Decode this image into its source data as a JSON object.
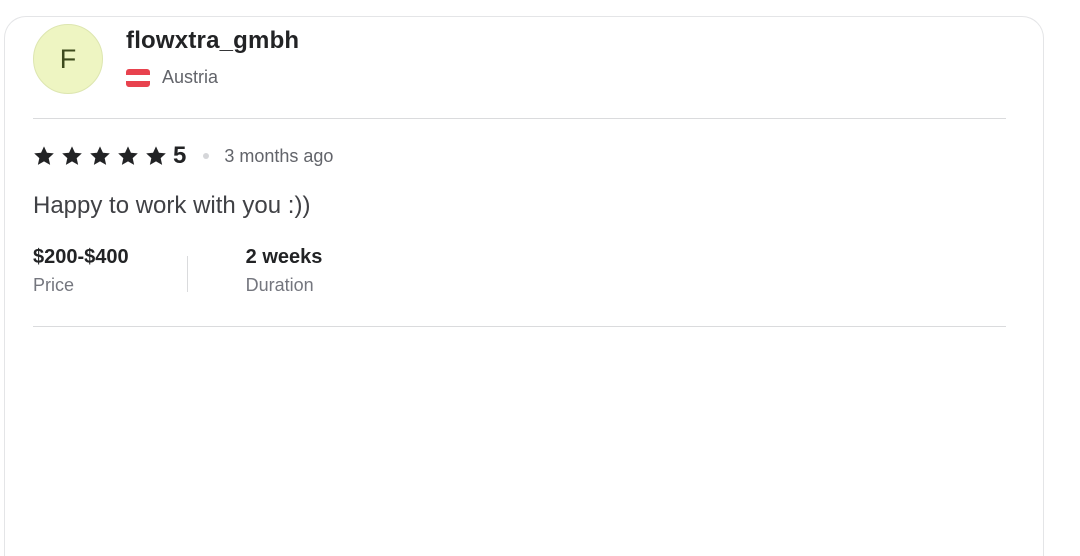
{
  "reviewer": {
    "avatar_initial": "F",
    "username": "flowxtra_gmbh",
    "country": "Austria",
    "flag_icon": "austria-flag-icon"
  },
  "review": {
    "rating": 5,
    "rating_label": "5",
    "star_icon": "star-icon",
    "time_ago": "3 months ago",
    "text": "Happy to work with you :))"
  },
  "stats": {
    "price_value": "$200-$400",
    "price_label": "Price",
    "duration_value": "2 weeks",
    "duration_label": "Duration"
  },
  "colors": {
    "avatar_bg": "#eef5c2",
    "star": "#222325",
    "flag_red": "#e8424e"
  }
}
